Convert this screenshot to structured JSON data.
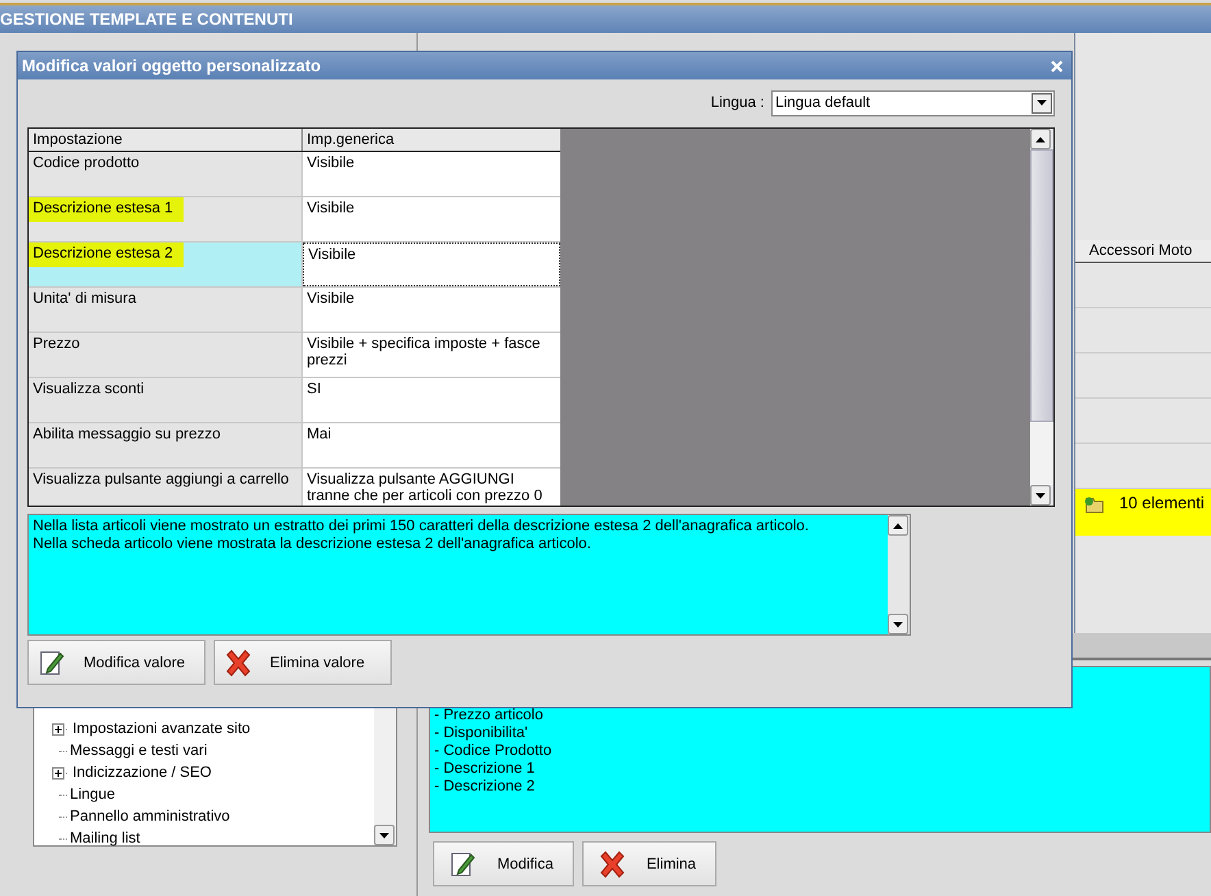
{
  "app": {
    "title": "GESTIONE TEMPLATE E CONTENUTI"
  },
  "tree": {
    "items": [
      {
        "label": "Impostazioni avanzate sito",
        "expandable": true
      },
      {
        "label": "Messaggi e testi vari",
        "expandable": false
      },
      {
        "label": "Indicizzazione / SEO",
        "expandable": true
      },
      {
        "label": "Lingue",
        "expandable": false
      },
      {
        "label": "Pannello amministrativo",
        "expandable": false
      },
      {
        "label": "Mailing list",
        "expandable": false
      }
    ]
  },
  "grid_panel": {
    "column": "Accessori Moto",
    "summary": "10 elementi"
  },
  "info_text": {
    "lines": [
      "- Prezzo articolo",
      "- Disponibilita'",
      "- Codice Prodotto",
      "- Descrizione 1",
      "- Descrizione 2"
    ]
  },
  "buttons": [
    {
      "label": "Modifica",
      "kind": "edit"
    },
    {
      "label": "Elimina",
      "kind": "delete"
    }
  ],
  "dialog": {
    "title": "Modifica valori oggetto personalizzato",
    "language": {
      "label": "Lingua :",
      "value": "Lingua default"
    },
    "table": {
      "columns": [
        "Impostazione",
        "Imp.generica"
      ],
      "rows": [
        {
          "setting": "Codice prodotto",
          "value": "Visibile",
          "selected": false,
          "highlighted": false
        },
        {
          "setting": "Descrizione estesa 1",
          "value": "Visibile",
          "selected": false,
          "highlighted": true
        },
        {
          "setting": "Descrizione estesa 2",
          "value": "Visibile",
          "selected": true,
          "highlighted": true
        },
        {
          "setting": "Unita' di misura",
          "value": "Visibile",
          "selected": false,
          "highlighted": false
        },
        {
          "setting": "Prezzo",
          "value": "Visibile + specifica imposte + fasce prezzi",
          "selected": false,
          "highlighted": false
        },
        {
          "setting": "Visualizza sconti",
          "value": "SI",
          "selected": false,
          "highlighted": false
        },
        {
          "setting": "Abilita messaggio su prezzo",
          "value": "Mai",
          "selected": false,
          "highlighted": false
        },
        {
          "setting": "Visualizza pulsante aggiungi a carrello",
          "value": "Visualizza pulsante AGGIUNGI tranne che per articoli con prezzo 0",
          "selected": false,
          "highlighted": false
        }
      ]
    },
    "description": [
      "Nella lista articoli viene mostrato un estratto dei primi 150 caratteri della descrizione estesa 2 dell'anagrafica articolo.",
      "Nella scheda articolo viene mostrata la descrizione estesa 2 dell'anagrafica articolo."
    ],
    "buttons": [
      {
        "label": "Modifica valore",
        "kind": "edit"
      },
      {
        "label": "Elimina valore",
        "kind": "delete"
      }
    ]
  }
}
